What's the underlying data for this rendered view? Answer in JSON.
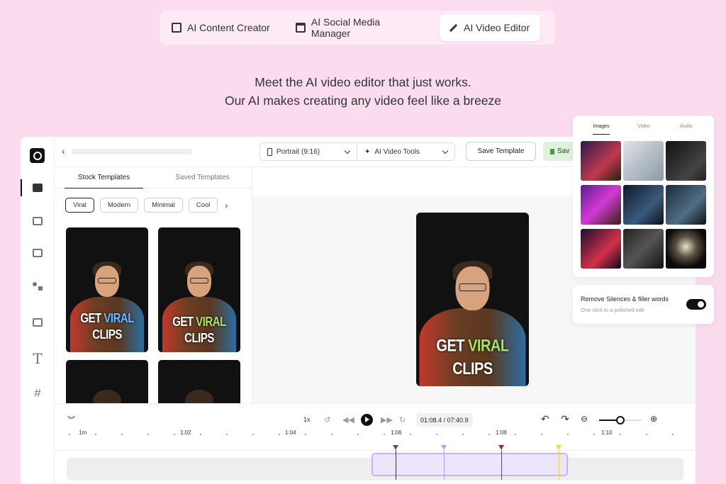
{
  "top_tabs": [
    {
      "label": "AI Content Creator",
      "icon": "document-icon"
    },
    {
      "label": "AI Social Media Manager",
      "icon": "calendar-icon"
    },
    {
      "label": "AI Video Editor",
      "icon": "magic-wand-icon",
      "active": true
    }
  ],
  "headline": {
    "line1": "Meet the AI video editor that just works.",
    "line2": "Our AI makes creating any video feel like a breeze"
  },
  "header": {
    "back_icon": "chevron-left-icon",
    "aspect_dropdown": "Portrait (9:16)",
    "tools_dropdown": "AI Video Tools",
    "save_template": "Save Template",
    "save_label": "Sav"
  },
  "left_panel": {
    "tabs": [
      "Stock Templates",
      "Saved Templates"
    ],
    "chips": [
      "Viral",
      "Modern",
      "Minimal",
      "Cool"
    ],
    "template_caption": {
      "word1": "GET",
      "word2": "VIRAL",
      "word3": "CLIPS"
    }
  },
  "preview": {
    "word1": "GET",
    "word2": "VIRAL",
    "word3": "CLIPS"
  },
  "timeline": {
    "speed": "1x",
    "timecode": "01:08.4 / 07:40.9",
    "zoom_level": 0.5,
    "ticks": [
      "1m",
      "1:02",
      "1:04",
      "1:06",
      "1:08",
      "1:10"
    ]
  },
  "media_panel": {
    "tabs": [
      "Images",
      "Video",
      "Audio"
    ]
  },
  "silence_panel": {
    "title": "Remove Silences & filler words",
    "subtitle": "One click to a polished edit",
    "enabled": true
  },
  "colors": {
    "background": "#fbdcef",
    "accent_purple": "#c9b3f3",
    "caption_blue": "#6ab8ff",
    "caption_green": "#a9e069",
    "save_green": "#dff2dc"
  }
}
